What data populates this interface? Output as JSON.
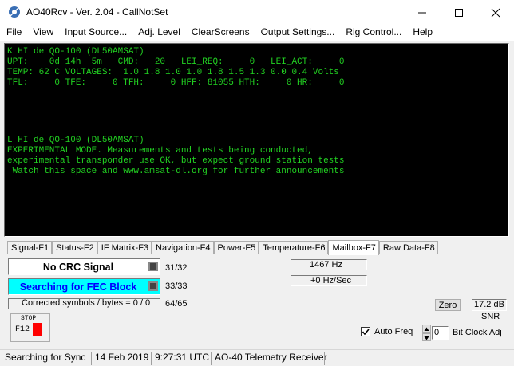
{
  "window": {
    "title": "AO40Rcv - Ver. 2.04 - CallNotSet"
  },
  "menu": [
    "File",
    "View",
    "Input Source...",
    "Adj. Level",
    "ClearScreens",
    "Output Settings...",
    "Rig Control...",
    "Help"
  ],
  "terminal": {
    "lines": [
      "K HI de QO-100 (DL50AMSAT)",
      "UPT:    0d 14h  5m   CMD:   20   LEI_REQ:     0   LEI_ACT:     0",
      "TEMP: 62 C VOLTAGES:  1.0 1.8 1.0 1.0 1.8 1.5 1.3 0.0 0.4 Volts",
      "TFL:     0 TFE:     0 TFH:     0 HFF: 81055 HTH:     0 HR:     0",
      "L HI de QO-100 (DL50AMSAT)",
      "EXPERIMENTAL MODE. Measurements and tests being conducted,",
      "experimental transponder use OK, but expect ground station tests",
      " Watch this space and www.amsat-dl.org for further announcements"
    ]
  },
  "tabs": [
    "Signal-F1",
    "Status-F2",
    "IF Matrix-F3",
    "Navigation-F4",
    "Power-F5",
    "Temperature-F6",
    "Mailbox-F7",
    "Raw Data-F8"
  ],
  "active_tab_index": 6,
  "signal": {
    "crc_label": "No CRC Signal",
    "crc_count": "31/32",
    "fec_label": "Searching for FEC Block",
    "fec_count": "33/33",
    "corrected_label": "Corrected symbols / bytes = 0 / 0",
    "corrected_count": "64/65",
    "stop_label": "STOP",
    "f12_label": "F12",
    "freq": "1467 Hz",
    "drift": "+0 Hz/Sec",
    "zero_label": "Zero",
    "snr_value": "17.2 dB",
    "snr_label": "SNR",
    "auto_freq_label": "Auto Freq",
    "auto_freq_checked": true,
    "bit_clock_value": "0",
    "bit_clock_label": "Bit Clock Adj"
  },
  "colors": {
    "terminal_text": "#22d322",
    "fec_bg": "#00ffff",
    "fec_text": "#0000ff",
    "stop_indicator": "#ff0000"
  },
  "status": {
    "sync": "Searching for Sync",
    "date": "14 Feb 2019",
    "time": "9:27:31 UTC",
    "app": "AO-40 Telemetry Receiver"
  }
}
